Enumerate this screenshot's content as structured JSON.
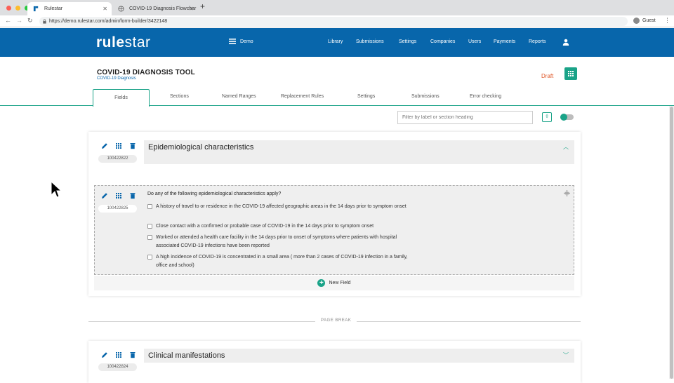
{
  "browser": {
    "tabs": [
      {
        "title": "Rulestar",
        "active": true
      },
      {
        "title": "COVID-19 Diagnosis Flowchar",
        "active": false
      }
    ],
    "url": "https://demo.rulestar.com/admin/form-builder/3422148",
    "profile": "Guest"
  },
  "app": {
    "logo_bold": "rule",
    "logo_light": "star",
    "workspace": "Demo",
    "menu": [
      "Library",
      "Submissions",
      "Settings",
      "Companies",
      "Users",
      "Payments",
      "Reports"
    ],
    "colors": {
      "header": "#0866ab",
      "accent": "#1aa388",
      "draft": "#e0592a"
    }
  },
  "form": {
    "title": "COVID-19 DIAGNOSIS TOOL",
    "subtitle": "COVID-19 Diagnosis",
    "status": "Draft",
    "tabs": [
      "Fields",
      "Sections",
      "Named Ranges",
      "Replacement Rules",
      "Settings",
      "Submissions",
      "Error checking"
    ],
    "active_tab": "Fields",
    "filter_placeholder": "Filter by label or section heading"
  },
  "sections": [
    {
      "id": "100422822",
      "heading": "Epidemiological characteristics",
      "expanded": true,
      "fields": [
        {
          "id": "100422825",
          "question": "Do any of the following epidemiological characteristics apply?",
          "options": [
            "A history of travel to or residence in the COVID-19 affected geographic areas in the 14 days prior to symptom onset",
            "Close contact with a confirmed or probable case of COVID-19 in the 14 days prior to symptom onset",
            "Worked or attended a health care facility in the 14 days prior to onset of symptoms where patients with hospital associated COVID-19 infections have been reported",
            "A high incidence of COVID-19 is concentrated in a small area ( more than 2 cases of COVID-19 infection in a family, office and school)"
          ]
        }
      ],
      "new_field_label": "New Field"
    },
    {
      "id": "100422824",
      "heading": "Clinical manifestations",
      "expanded": false
    }
  ],
  "page_break_label": "PAGE BREAK"
}
